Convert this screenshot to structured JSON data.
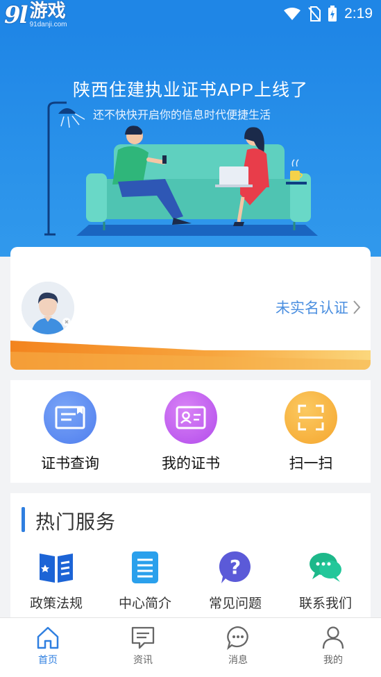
{
  "watermark": {
    "logo": "9l",
    "brand": "游戏",
    "url": "91danji.com"
  },
  "status_bar": {
    "time": "2:19"
  },
  "banner": {
    "title": "陕西住建执业证书APP上线了",
    "subtitle": "还不快快开启你的信息时代便捷生活"
  },
  "profile": {
    "verify_label": "未实名认证"
  },
  "quick_actions": [
    {
      "label": "证书查询",
      "icon": "certificate-search-icon",
      "color": "#5d8df2"
    },
    {
      "label": "我的证书",
      "icon": "id-card-icon",
      "color": "#c55ff0"
    },
    {
      "label": "扫一扫",
      "icon": "scan-icon",
      "color": "#f7b33a"
    }
  ],
  "services": {
    "title": "热门服务",
    "items": [
      {
        "label": "政策法规",
        "icon": "policy-book-icon"
      },
      {
        "label": "中心简介",
        "icon": "document-icon"
      },
      {
        "label": "常见问题",
        "icon": "question-icon"
      },
      {
        "label": "联系我们",
        "icon": "chat-icon"
      }
    ]
  },
  "bottom_nav": [
    {
      "label": "首页",
      "icon": "home-icon",
      "active": true
    },
    {
      "label": "资讯",
      "icon": "news-icon",
      "active": false
    },
    {
      "label": "消息",
      "icon": "message-icon",
      "active": false
    },
    {
      "label": "我的",
      "icon": "user-icon",
      "active": false
    }
  ],
  "colors": {
    "primary": "#1f86e6",
    "accent_orange": "#f48a2c",
    "nav_active": "#2f7fe0"
  }
}
